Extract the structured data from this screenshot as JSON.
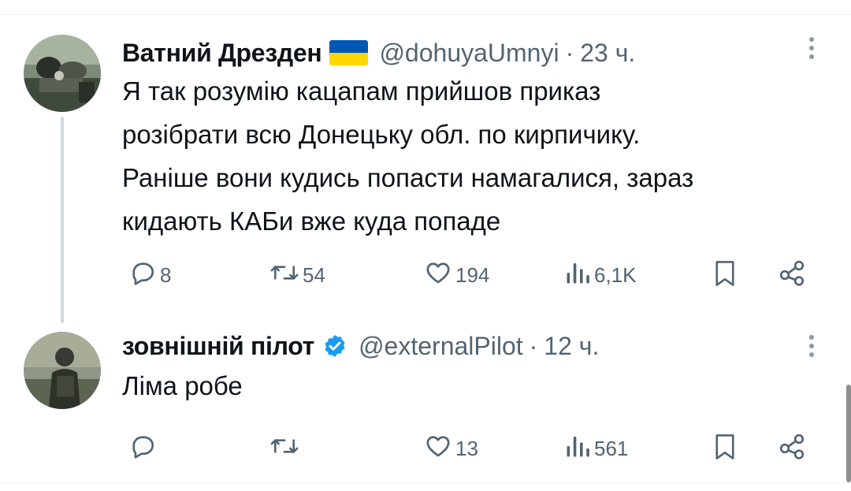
{
  "tweets": [
    {
      "name": "Ватний Дрезден",
      "handle": "@dohuyaUmnyi",
      "separator": "·",
      "time": "23 ч.",
      "text_lines": [
        "Я так розумію кацапам прийшов приказ",
        "розібрати всю Донецьку обл. по кирпичику.",
        "Раніше вони кудись попасти намагалися, зараз",
        "кидають КАБи вже куда попаде"
      ],
      "stats": {
        "replies": "8",
        "reposts": "54",
        "likes": "194",
        "views": "6,1K"
      },
      "badge": "ukraine-flag"
    },
    {
      "name": "зовнішній пілот",
      "handle": "@externalPilot",
      "separator": "·",
      "time": "12 ч.",
      "text_lines": [
        "Ліма робе"
      ],
      "stats": {
        "replies": "",
        "reposts": "",
        "likes": "13",
        "views": "561"
      },
      "badge": "verified-check"
    }
  ],
  "colors": {
    "text": "#0f1419",
    "secondary": "#536471",
    "verified_blue": "#1d9bf0",
    "flag_blue": "#0057b7",
    "flag_yellow": "#ffd700",
    "thread_line": "#cfd9de"
  },
  "icons": {
    "reply": "reply-icon",
    "repost": "repost-icon",
    "like": "heart-icon",
    "views": "views-icon",
    "bookmark": "bookmark-icon",
    "share": "share-icon",
    "more": "more-vertical-icon"
  }
}
